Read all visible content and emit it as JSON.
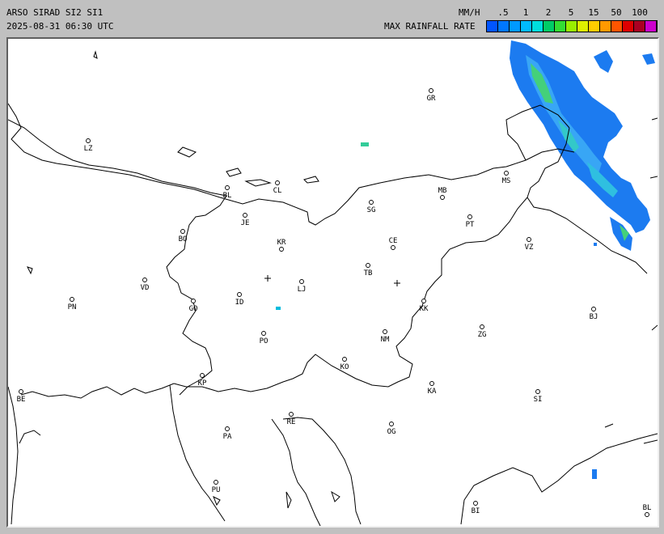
{
  "header": {
    "title": "ARSO SIRAD SI2 SI1",
    "timestamp": "2025-08-31 06:30 UTC",
    "unit": "MM/H",
    "scale_title": "MAX RAINFALL RATE",
    "tick_labels": [
      ".5",
      "1",
      "2",
      "5",
      "15",
      "50",
      "100"
    ],
    "colors": [
      "#0055ff",
      "#0077ff",
      "#0099ff",
      "#00bbff",
      "#00dddd",
      "#00cc66",
      "#33dd33",
      "#99ee00",
      "#ddee00",
      "#ffcc00",
      "#ff9900",
      "#ff5500",
      "#dd0000",
      "#aa0022",
      "#cc00cc"
    ]
  },
  "map": {
    "crosshair_icons": [
      "radar-site-icon",
      "radar-site-icon"
    ],
    "cities": [
      {
        "code": "GR"
      },
      {
        "code": "LZ"
      },
      {
        "code": "MS"
      },
      {
        "code": "BL"
      },
      {
        "code": "CL"
      },
      {
        "code": "MB"
      },
      {
        "code": "JE"
      },
      {
        "code": "SG"
      },
      {
        "code": "PT"
      },
      {
        "code": "BO"
      },
      {
        "code": "KR"
      },
      {
        "code": "CE"
      },
      {
        "code": "VZ"
      },
      {
        "code": "VD"
      },
      {
        "code": "TB"
      },
      {
        "code": "LJ"
      },
      {
        "code": "PN"
      },
      {
        "code": "ID"
      },
      {
        "code": "GO"
      },
      {
        "code": "KK"
      },
      {
        "code": "BJ"
      },
      {
        "code": "PO"
      },
      {
        "code": "ZG"
      },
      {
        "code": "NM"
      },
      {
        "code": "KO"
      },
      {
        "code": "KP"
      },
      {
        "code": "KA"
      },
      {
        "code": "SI"
      },
      {
        "code": "BE"
      },
      {
        "code": "RE"
      },
      {
        "code": "PA"
      },
      {
        "code": "OG"
      },
      {
        "code": "PU"
      },
      {
        "code": "BI"
      },
      {
        "code": "BL"
      }
    ]
  }
}
